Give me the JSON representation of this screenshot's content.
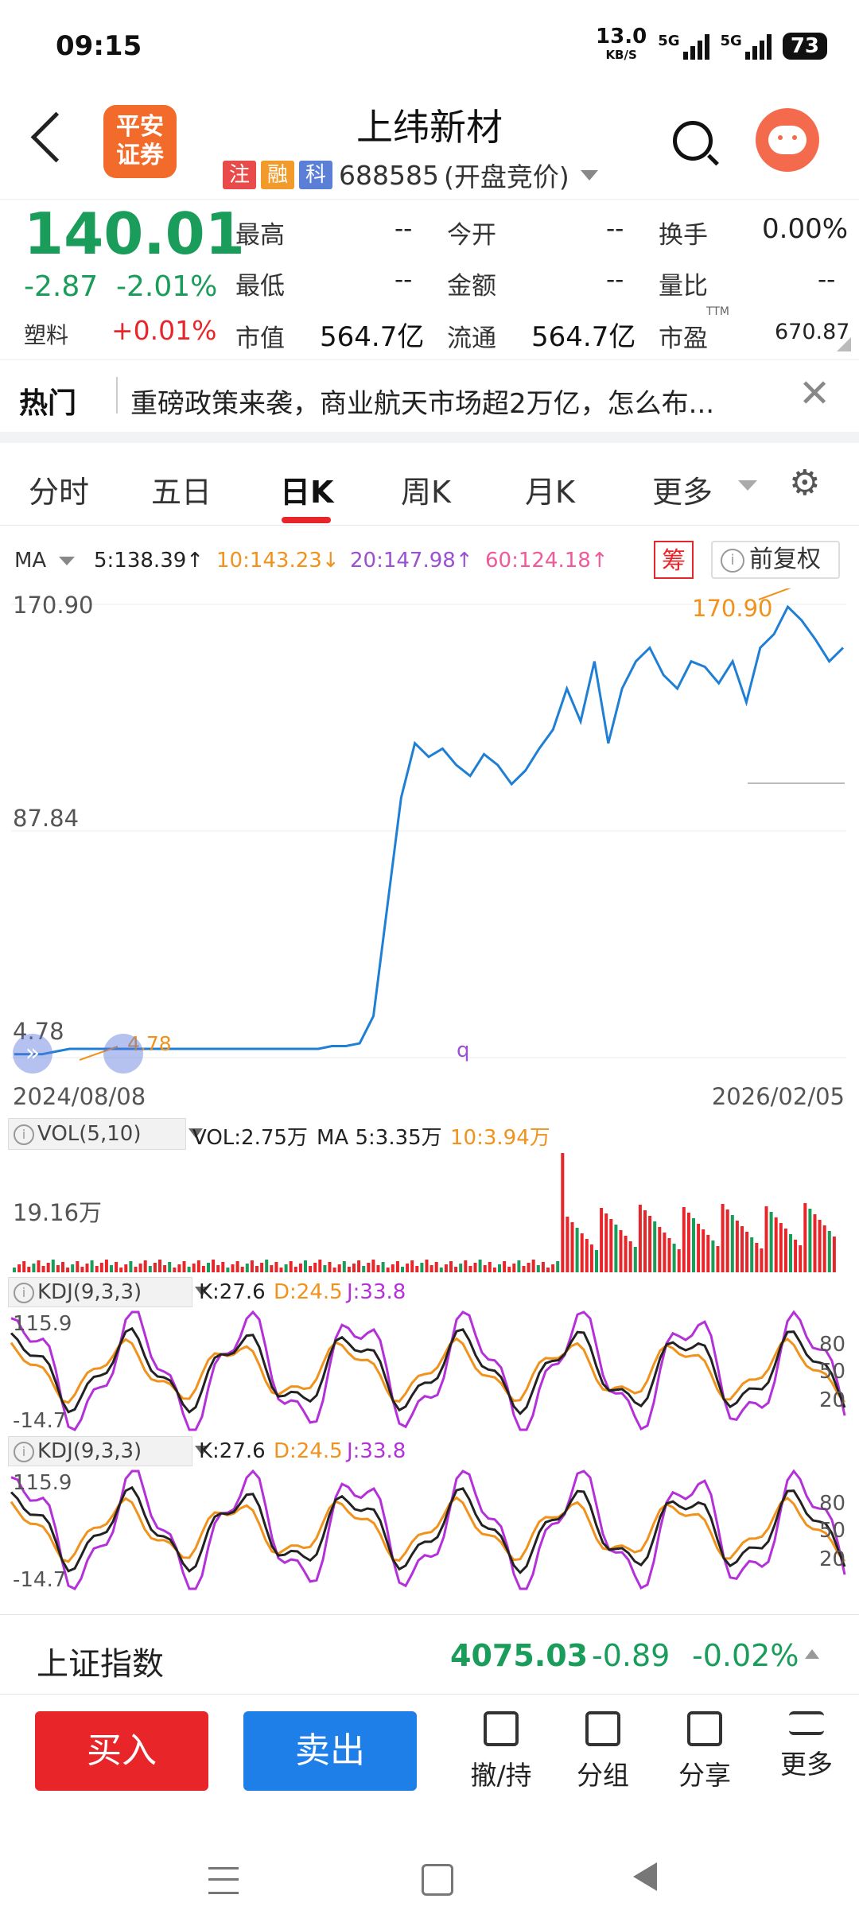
{
  "status_bar": {
    "time": "09:15",
    "net_speed_top": "13.0",
    "net_speed_unit": "KB/S",
    "net1": "5G",
    "net2": "5G",
    "battery": "73"
  },
  "header": {
    "title": "上纬新材",
    "logo_line1": "平安",
    "logo_line2": "证券",
    "tags": [
      "注",
      "融",
      "科"
    ],
    "code": "688585",
    "status": "(开盘竞价)"
  },
  "quote": {
    "price": "140.01",
    "change": "-2.87",
    "change_pct": "-2.01%",
    "sector_name": "塑料",
    "sector_pct": "+0.01%",
    "cells": {
      "high_lbl": "最高",
      "high": "--",
      "open_lbl": "今开",
      "open": "--",
      "turnover_lbl": "换手",
      "turnover": "0.00%",
      "low_lbl": "最低",
      "low": "--",
      "amount_lbl": "金额",
      "amount": "--",
      "vol_ratio_lbl": "量比",
      "vol_ratio": "--",
      "mcap_lbl": "市值",
      "mcap": "564.7亿",
      "float_lbl": "流通",
      "float": "564.7亿",
      "pe_lbl": "市盈",
      "pe_sup": "TTM",
      "pe": "670.87"
    }
  },
  "hot": {
    "label": "热门",
    "text": "重磅政策来袭，商业航天市场超2万亿，怎么布..."
  },
  "tabs": [
    "分时",
    "五日",
    "日K",
    "周K",
    "月K",
    "更多"
  ],
  "active_tab": "日K",
  "ma_bar": {
    "label": "MA",
    "ma5": "5:138.39↑",
    "ma10": "10:143.23↓",
    "ma20": "20:147.98↑",
    "ma60": "60:124.18↑",
    "chip": "筹",
    "adjust": "前复权"
  },
  "colors": {
    "up": "#e8262a",
    "down": "#1a9c5a",
    "ma5": "#222222",
    "ma10": "#f0921c",
    "ma20": "#9b4fd1",
    "ma60": "#ef5a9a",
    "price_line": "#1f7fd4",
    "kdj_j": "#b430d8"
  },
  "main_chart": {
    "y_top": "170.90",
    "y_mid": "87.84",
    "y_bot": "4.78",
    "hi_label": "170.90",
    "lo_label": "4.78",
    "x_start": "2024/08/08",
    "x_end": "2026/02/05"
  },
  "vol_panel": {
    "label": "VOL(5,10)",
    "vol": "VOL:2.75万",
    "ma5": "MA 5:3.35万",
    "ma10": "10:3.94万",
    "y_top": "19.16万"
  },
  "kdj1": {
    "label": "KDJ(9,3,3)",
    "k": "K:27.6",
    "d": "D:24.5",
    "j": "J:33.8",
    "top": "115.9",
    "bot": "-14.7",
    "l80": "80",
    "l50": "50",
    "l20": "20"
  },
  "kdj2": {
    "label": "KDJ(9,3,3)",
    "k": "K:27.6",
    "d": "D:24.5",
    "j": "J:33.8",
    "top": "115.9",
    "bot": "-14.7",
    "l80": "80",
    "l50": "50",
    "l20": "20"
  },
  "index_bar": {
    "name": "上证指数",
    "value": "4075.03",
    "change": "-0.89",
    "pct": "-0.02%"
  },
  "toolbar": {
    "buy": "买入",
    "sell": "卖出",
    "t1": "撤/持",
    "t2": "分组",
    "t3": "分享",
    "t4": "更多"
  },
  "chart_data": {
    "type": "line",
    "title": "",
    "x_range": [
      "2024/08/08",
      "2026/02/05"
    ],
    "ylim": [
      4.78,
      170.9
    ],
    "series": [
      {
        "name": "",
        "values": [
          6,
          6,
          6,
          7,
          8,
          8,
          8,
          8,
          8,
          8,
          8,
          8,
          8,
          8,
          8,
          8,
          8,
          8,
          8,
          8,
          8,
          8,
          8,
          9,
          9,
          10,
          20,
          60,
          100,
          120,
          115,
          118,
          112,
          108,
          116,
          112,
          105,
          110,
          118,
          125,
          140,
          128,
          150,
          120,
          140,
          150,
          155,
          145,
          140,
          150,
          148,
          142,
          150,
          135,
          155,
          160,
          170,
          165,
          158,
          150,
          155
        ]
      }
    ]
  }
}
